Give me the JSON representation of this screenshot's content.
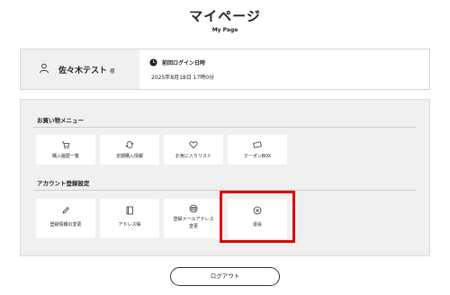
{
  "page": {
    "title": "マイページ",
    "subtitle": "My Page"
  },
  "user": {
    "name": "佐々木テスト",
    "honorific": "様",
    "last_login_label": "前回ログイン日時",
    "last_login_value": "2025年8月18日 17時0分"
  },
  "shopping_menu": {
    "heading": "お買い物メニュー",
    "items": [
      {
        "label": "購入履歴一覧",
        "icon": "cart-icon"
      },
      {
        "label": "定期購入情報",
        "icon": "repeat-icon"
      },
      {
        "label": "お気に入りリスト",
        "icon": "heart-icon"
      },
      {
        "label": "クーポンBOX",
        "icon": "coupon-icon"
      }
    ]
  },
  "account_settings": {
    "heading": "アカウント登録設定",
    "items": [
      {
        "label": "登録情報の変更",
        "icon": "pencil-icon"
      },
      {
        "label": "アドレス帳",
        "icon": "address-book-icon"
      },
      {
        "label_line1": "登録メールアドレス",
        "label_line2": "変更",
        "icon": "email-change-icon"
      },
      {
        "label": "退会",
        "icon": "close-circle-icon"
      }
    ]
  },
  "logout": {
    "label": "ログアウト"
  },
  "colors": {
    "highlight": "#e00000",
    "panel_bg": "#f0f0f0"
  }
}
